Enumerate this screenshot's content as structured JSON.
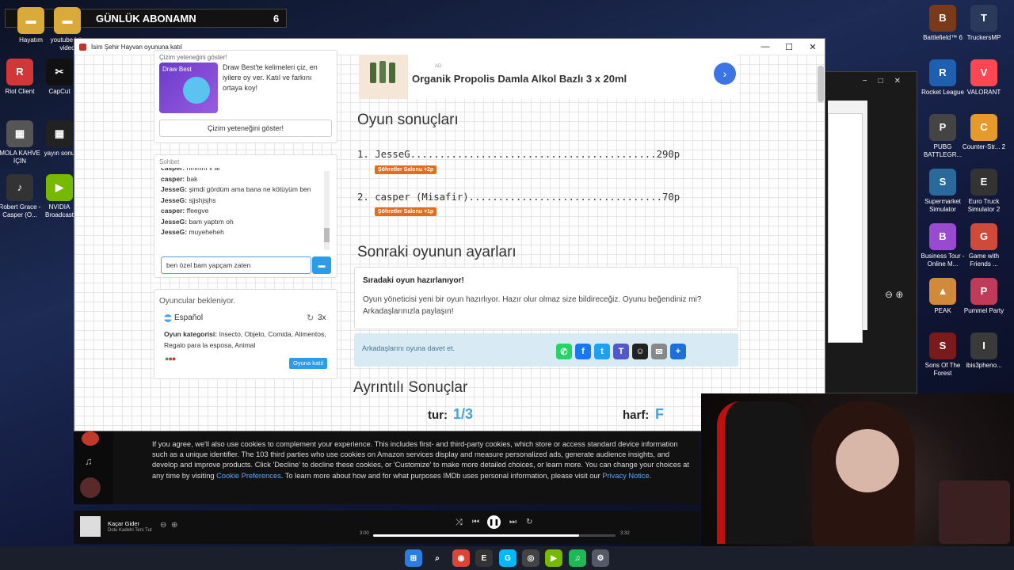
{
  "overlay": {
    "title": "GÜNLÜK ABONAMN",
    "count": "6"
  },
  "desktop_left": [
    {
      "label": "Hayatım",
      "color": "#d9a93a",
      "icon": "folder-icon",
      "glyph": "▬"
    },
    {
      "label": "youtube için video",
      "color": "#d9a93a",
      "icon": "folder-icon",
      "glyph": "▬"
    },
    {
      "label": "Riot Client",
      "color": "#d13639",
      "icon": "riot-icon",
      "glyph": "R"
    },
    {
      "label": "CapCut",
      "color": "#111111",
      "icon": "capcut-icon",
      "glyph": "✂"
    },
    {
      "label": "MOLA KAHVE İÇİN",
      "color": "#555555",
      "icon": "image-icon",
      "glyph": "▦"
    },
    {
      "label": "yayın sonu",
      "color": "#222222",
      "icon": "image-icon",
      "glyph": "▦"
    },
    {
      "label": "Robert Grace - Casper (O...",
      "color": "#333333",
      "icon": "audio-icon",
      "glyph": "♪"
    },
    {
      "label": "NVIDIA Broadcast",
      "color": "#76b900",
      "icon": "nvidia-icon",
      "glyph": "▶"
    }
  ],
  "desktop_right": [
    {
      "label": "Battlefield™ 6",
      "color": "#7a3a1a",
      "icon": "battlefield-icon",
      "glyph": "B"
    },
    {
      "label": "TruckersMP",
      "color": "#2b3a5a",
      "icon": "truckersmp-icon",
      "glyph": "T"
    },
    {
      "label": "Rocket League",
      "color": "#1f5fb0",
      "icon": "rocket-league-icon",
      "glyph": "R"
    },
    {
      "label": "VALORANT",
      "color": "#ff4655",
      "icon": "valorant-icon",
      "glyph": "V"
    },
    {
      "label": "PUBG BATTLEGR...",
      "color": "#444444",
      "icon": "pubg-icon",
      "glyph": "P"
    },
    {
      "label": "Counter-Str... 2",
      "color": "#e69a2a",
      "icon": "cs2-icon",
      "glyph": "C"
    },
    {
      "label": "Supermarket Simulator",
      "color": "#2a6a9a",
      "icon": "supermarket-icon",
      "glyph": "S"
    },
    {
      "label": "Euro Truck Simulator 2",
      "color": "#333333",
      "icon": "ets2-icon",
      "glyph": "E"
    },
    {
      "label": "Business Tour - Online M...",
      "color": "#9a4ad0",
      "icon": "business-tour-icon",
      "glyph": "B"
    },
    {
      "label": "Game with Friends ...",
      "color": "#d04a3a",
      "icon": "game-friends-icon",
      "glyph": "G"
    },
    {
      "label": "PEAK",
      "color": "#d08a3a",
      "icon": "peak-icon",
      "glyph": "▲"
    },
    {
      "label": "Pummel Party",
      "color": "#c03a5a",
      "icon": "pummel-party-icon",
      "glyph": "P"
    },
    {
      "label": "Sons Of The Forest",
      "color": "#7a1a1a",
      "icon": "sons-forest-icon",
      "glyph": "S"
    },
    {
      "label": "ibis3pheno...",
      "color": "#3a3a3a",
      "icon": "ibis-icon",
      "glyph": "I"
    }
  ],
  "window": {
    "title": "İsim Şehir Hayvan oyununa katıl"
  },
  "promo": {
    "header": "Çizim yeteneğini göster!",
    "logo_text": "Draw Best",
    "description": "Draw Best'te kelimeleri çiz, en iyilere oy ver. Katıl ve farkını ortaya koy!",
    "button": "Çizim yeteneğini göster!"
  },
  "chat": {
    "header": "Sohbet",
    "messages": [
      {
        "user": "casper:",
        "text": "hmmm v ar"
      },
      {
        "user": "casper:",
        "text": "bak"
      },
      {
        "user": "JesseG:",
        "text": "şimdi gördüm ama bana ne kötüyüm ben"
      },
      {
        "user": "JesseG:",
        "text": "sjjshjsjhs"
      },
      {
        "user": "casper:",
        "text": "ffeegve"
      },
      {
        "user": "JesseG:",
        "text": "bam yaptım oh"
      },
      {
        "user": "JesseG:",
        "text": "muyeheheh"
      }
    ],
    "input_value": "ben özel bam yapçam zaten"
  },
  "waiting": {
    "title": "Oyuncular bekleniyor.",
    "language": "Español",
    "rounds": "3x",
    "category_label": "Oyun kategorisi:",
    "categories": "Insecto, Objeto, Comida, Alimentos, Regalo para la esposa, Animal",
    "join": "Oyuna katıl"
  },
  "ad": {
    "tag": "AD",
    "title": "Organik Propolis Damla Alkol Bazlı 3 x 20ml"
  },
  "results": {
    "title": "Oyun sonuçları",
    "rows": [
      {
        "line": "1. JesseG..........................................290p",
        "badge": "Şöhretler Salonu +2p"
      },
      {
        "line": "2. casper (Misafir).................................70p",
        "badge": "Şöhretler Salonu +1p"
      }
    ]
  },
  "next": {
    "title": "Sonraki oyunun ayarları",
    "heading": "Sıradaki oyun hazırlanıyor!",
    "body": "Oyun yöneticisi yeni bir oyun hazırlıyor. Hazır olur olmaz size bildireceğiz. Oyunu beğendiniz mi? Arkadaşlarınızla paylaşın!"
  },
  "invite": {
    "text": "Arkadaşlarını oyuna davet et.",
    "shares": [
      {
        "icon": "whatsapp-icon",
        "color": "#25d366",
        "glyph": "✆"
      },
      {
        "icon": "facebook-icon",
        "color": "#1877f2",
        "glyph": "f"
      },
      {
        "icon": "twitter-icon",
        "color": "#1da1f2",
        "glyph": "t"
      },
      {
        "icon": "teams-icon",
        "color": "#5059c9",
        "glyph": "T"
      },
      {
        "icon": "snapchat-icon",
        "color": "#222222",
        "glyph": "☺"
      },
      {
        "icon": "email-icon",
        "color": "#888888",
        "glyph": "✉"
      },
      {
        "icon": "share-icon",
        "color": "#1e6fd9",
        "glyph": "+"
      }
    ]
  },
  "details": {
    "title": "Ayrıntılı Sonuçlar",
    "round_label": "tur:",
    "round_value": "1/3",
    "letter_label": "harf:",
    "letter_value": "F"
  },
  "cookie": {
    "text": "If you agree, we'll also use cookies to complement your experience. This includes first- and third-party cookies, which store or access standard device information such as a unique identifier. The 103 third parties who use cookies on Amazon services display and measure personalized ads, generate audience insights, and develop and improve products. Click 'Decline' to decline these cookies, or 'Customize' to make more detailed choices, or learn more. You can change your choices at any time by visiting ",
    "link1": "Cookie Preferences",
    "mid": ". To learn more about how and for what purposes IMDb uses personal information, please visit our ",
    "link2": "Privacy Notice",
    "end": "."
  },
  "player": {
    "title": "Kaçar Gider",
    "artist": "Dolu Kadehi Ters Tut",
    "elapsed": "3:00",
    "duration": "3:32",
    "progress": 0.85
  },
  "taskbar": [
    {
      "icon": "windows-start-icon",
      "color": "#2b7de0",
      "glyph": "⊞"
    },
    {
      "icon": "search-icon",
      "color": "#1b1e2b",
      "glyph": "⌕"
    },
    {
      "icon": "chrome-icon",
      "color": "#db4437",
      "glyph": "◉"
    },
    {
      "icon": "epic-games-icon",
      "color": "#333333",
      "glyph": "E"
    },
    {
      "icon": "logitech-icon",
      "color": "#00b8fc",
      "glyph": "G"
    },
    {
      "icon": "obs-icon",
      "color": "#444444",
      "glyph": "◎"
    },
    {
      "icon": "nvidia-app-icon",
      "color": "#76b900",
      "glyph": "▶"
    },
    {
      "icon": "spotify-icon",
      "color": "#1db954",
      "glyph": "♫"
    },
    {
      "icon": "settings-icon",
      "color": "#555a66",
      "glyph": "⚙"
    }
  ]
}
